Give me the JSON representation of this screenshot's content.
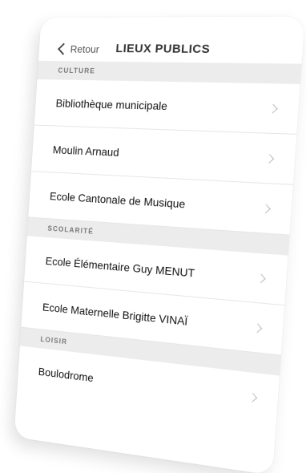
{
  "nav": {
    "back_label": "Retour",
    "title": "LIEUX PUBLICS"
  },
  "sections": [
    {
      "header": "CULTURE",
      "items": [
        {
          "label": "Bibliothèque municipale"
        },
        {
          "label": "Moulin Arnaud"
        },
        {
          "label": "Ecole Cantonale de Musique"
        }
      ]
    },
    {
      "header": "SCOLARITÉ",
      "items": [
        {
          "label": "Ecole Élémentaire Guy MENUT"
        },
        {
          "label": "Ecole Maternelle Brigitte VINAÏ"
        }
      ]
    },
    {
      "header": "LOISIR",
      "items": [
        {
          "label": "Boulodrome"
        }
      ]
    }
  ]
}
